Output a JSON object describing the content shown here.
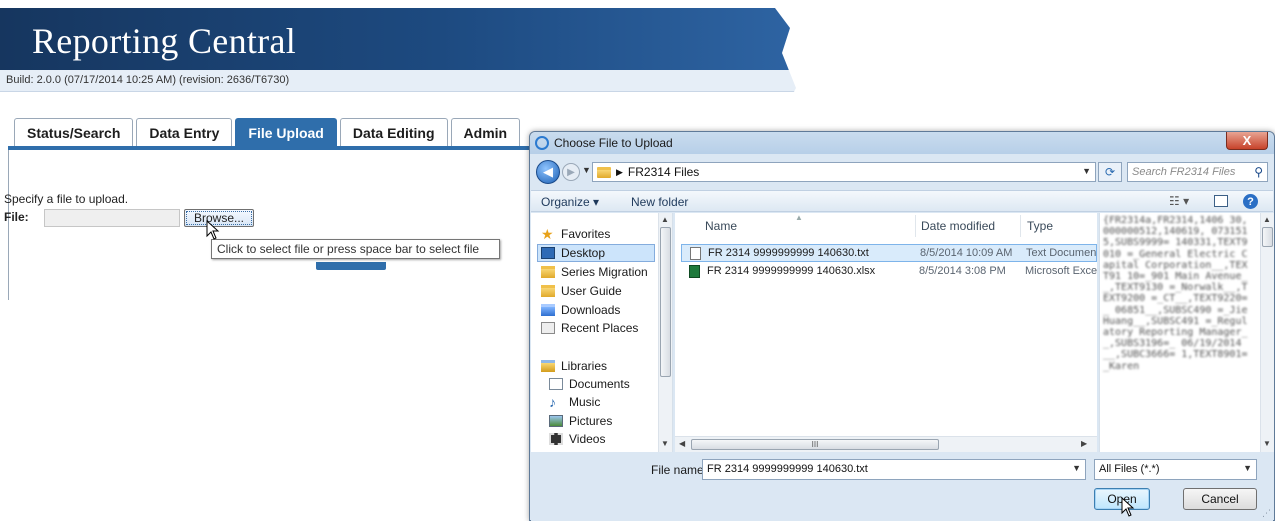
{
  "reporting_central": {
    "title": "Reporting Central",
    "build": "Build: 2.0.0 (07/17/2014 10:25 AM) (revision: 2636/T6730)",
    "tabs": [
      {
        "label": "Status/Search",
        "active": false
      },
      {
        "label": "Data Entry",
        "active": false
      },
      {
        "label": "File Upload",
        "active": true
      },
      {
        "label": "Data Editing",
        "active": false
      },
      {
        "label": "Admin",
        "active": false
      }
    ],
    "instruction": "Specify a file to upload.",
    "file_label": "File:",
    "browse_label": "Browse...",
    "tooltip": "Click to select file or press space bar to select file"
  },
  "dialog": {
    "title": "Choose File to Upload",
    "close_label": "X",
    "breadcrumb": "FR2314 Files",
    "search_placeholder": "Search FR2314 Files",
    "toolbar": {
      "organize": "Organize ▾",
      "new_folder": "New folder"
    },
    "nav": {
      "favorites": "Favorites",
      "desktop": "Desktop",
      "series_migration": "Series Migration",
      "user_guide": "User Guide",
      "downloads": "Downloads",
      "recent_places": "Recent Places",
      "libraries": "Libraries",
      "documents": "Documents",
      "music": "Music",
      "pictures": "Pictures",
      "videos": "Videos"
    },
    "columns": {
      "name": "Name",
      "date": "Date modified",
      "type": "Type"
    },
    "files": [
      {
        "name": "FR 2314 9999999999 140630.txt",
        "date": "8/5/2014 10:09 AM",
        "type": "Text Document",
        "selected": true
      },
      {
        "name": "FR 2314 9999999999 140630.xlsx",
        "date": "8/5/2014 3:08 PM",
        "type": "Microsoft Excel W",
        "selected": false
      }
    ],
    "preview_text": "{FR2314a,FR2314,1406 30,000000512,140619, 0731515,SUBS9999= 140331,TEXT9010 =_General Electric Capital Corporation__,TEXT91 10=_901 Main Avenue__,TEXT9130 =_Norwalk__,TEXT9200 =_CT__,TEXT9220=_ 06851__,SUBSC490 =_Jie Huang__,SUBSC491 =_Regulatory Reporting Manager__,SUBS3196=_ 06/19/2014 __,SUBC3666= 1,TEXT8901=_Karen",
    "hscroll_grip": "III",
    "file_name_label": "File name:",
    "file_name_value": "FR 2314 9999999999 140630.txt",
    "file_type": "All Files (*.*)",
    "open_label": "Open",
    "cancel_label": "Cancel"
  },
  "colors": {
    "header_blue": "#1d4a80",
    "tab_active": "#2f6eab",
    "dialog_frame": "#dbe7f3",
    "selection": "#d9ebfb"
  }
}
